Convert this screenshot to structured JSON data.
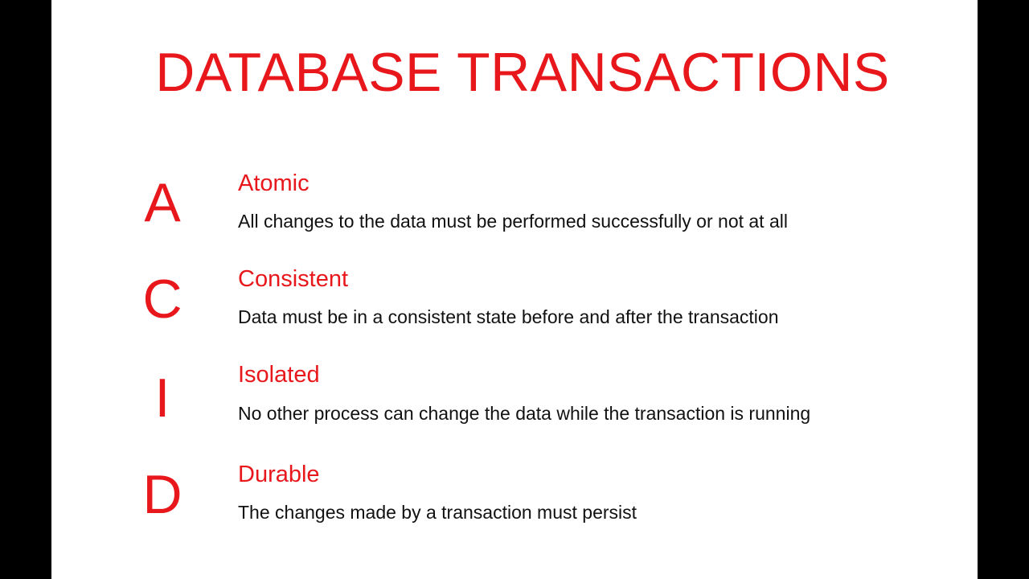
{
  "title": "DATABASE TRANSACTIONS",
  "accent_color": "#e8171b",
  "items": [
    {
      "letter": "A",
      "term": "Atomic",
      "description": "All changes to the data must be performed successfully or not at all"
    },
    {
      "letter": "C",
      "term": "Consistent",
      "description": "Data must be in a consistent state before and after the transaction"
    },
    {
      "letter": "I",
      "term": "Isolated",
      "description": "No other process can change the data while the transaction is running"
    },
    {
      "letter": "D",
      "term": "Durable",
      "description": "The changes made by a transaction must persist"
    }
  ]
}
